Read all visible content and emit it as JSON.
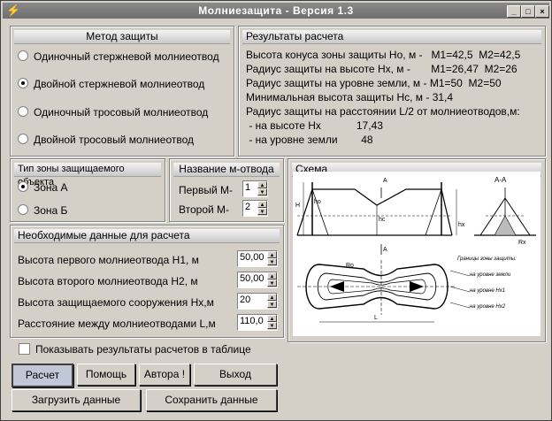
{
  "window": {
    "title": "Молниезащита - Версия 1.3"
  },
  "method": {
    "title": "Метод защиты",
    "options": [
      "Одиночный стержневой молниеотвод",
      "Двойной стержневой молниеотвод",
      "Одиночный тросовый молниеотвод",
      "Двойной тросовый молниеотвод"
    ],
    "selected_index": 1
  },
  "results": {
    "title": "Результаты расчета",
    "lines": [
      "Высота конуса зоны защиты Но, м -   М1=42,5  М2=42,5",
      "Радиус защиты на высоте Нх, м -       М1=26,47  М2=26",
      "Радиус защиты на уровне земли, м - М1=50  М2=50",
      "Минимальная высота защиты Нс, м - 31,4",
      "Радиус защиты на расстоянии L/2 от молниеотводов,м:",
      " - на высоте Нх            17,43",
      " - на уровне земли        48"
    ]
  },
  "zone_type": {
    "title": "Тип зоны защищаемого объекта",
    "options": [
      "Зона А",
      "Зона Б"
    ],
    "selected_index": 0
  },
  "rod_names": {
    "title": "Название м-отвода",
    "first_label": "Первый М-",
    "first_value": "1",
    "second_label": "Второй  М-",
    "second_value": "2"
  },
  "inputs": {
    "title": "Необходимые данные для расчета",
    "fields": [
      {
        "label": "Высота первого молниеотвода Н1, м",
        "value": "50,00"
      },
      {
        "label": "Высота второго молниеотвода Н2, м",
        "value": "50,00"
      },
      {
        "label": "Высота защищаемого сооружения Нх,м",
        "value": "20"
      },
      {
        "label": "Расстояние между молниеотводами L,м",
        "value": "110,0"
      }
    ]
  },
  "schema": {
    "title": "Схема",
    "section_label": "А-А",
    "marker_a": "А",
    "legend_title": "Границы зоны защиты:",
    "legend": [
      "на уровне земли",
      "на уровне Нх1",
      "на уровне Нх2"
    ],
    "dims": [
      "Н",
      "hо",
      "hс",
      "hх",
      "Rх",
      "Rо",
      "L"
    ]
  },
  "show_table": {
    "label": "Показывать результаты расчетов в таблице",
    "checked": false
  },
  "buttons": {
    "calc": "Расчет",
    "help": "Помощь",
    "authors": "Автора !",
    "exit": "Выход",
    "load": "Загрузить данные",
    "save": "Сохранить данные"
  }
}
